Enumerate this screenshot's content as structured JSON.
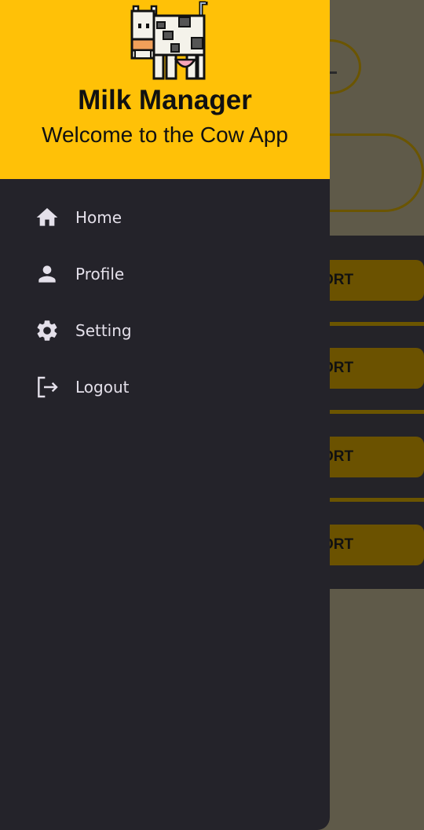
{
  "drawer": {
    "title": "Milk Manager",
    "subtitle": "Welcome to the Cow App",
    "logo_icon": "cow-icon",
    "items": [
      {
        "label": "Home",
        "icon": "home-icon"
      },
      {
        "label": "Profile",
        "icon": "person-icon"
      },
      {
        "label": "Setting",
        "icon": "gear-icon"
      },
      {
        "label": "Logout",
        "icon": "logout-icon"
      }
    ]
  },
  "background": {
    "buttons": [
      {
        "label": "ORT"
      },
      {
        "label": "ORT"
      },
      {
        "label": "ORT"
      },
      {
        "label": "ORT"
      }
    ]
  },
  "colors": {
    "accent": "#ffc107",
    "drawer_bg": "#24232a",
    "menu_text": "#e4e0ea",
    "scrim": "#5f5a49"
  }
}
